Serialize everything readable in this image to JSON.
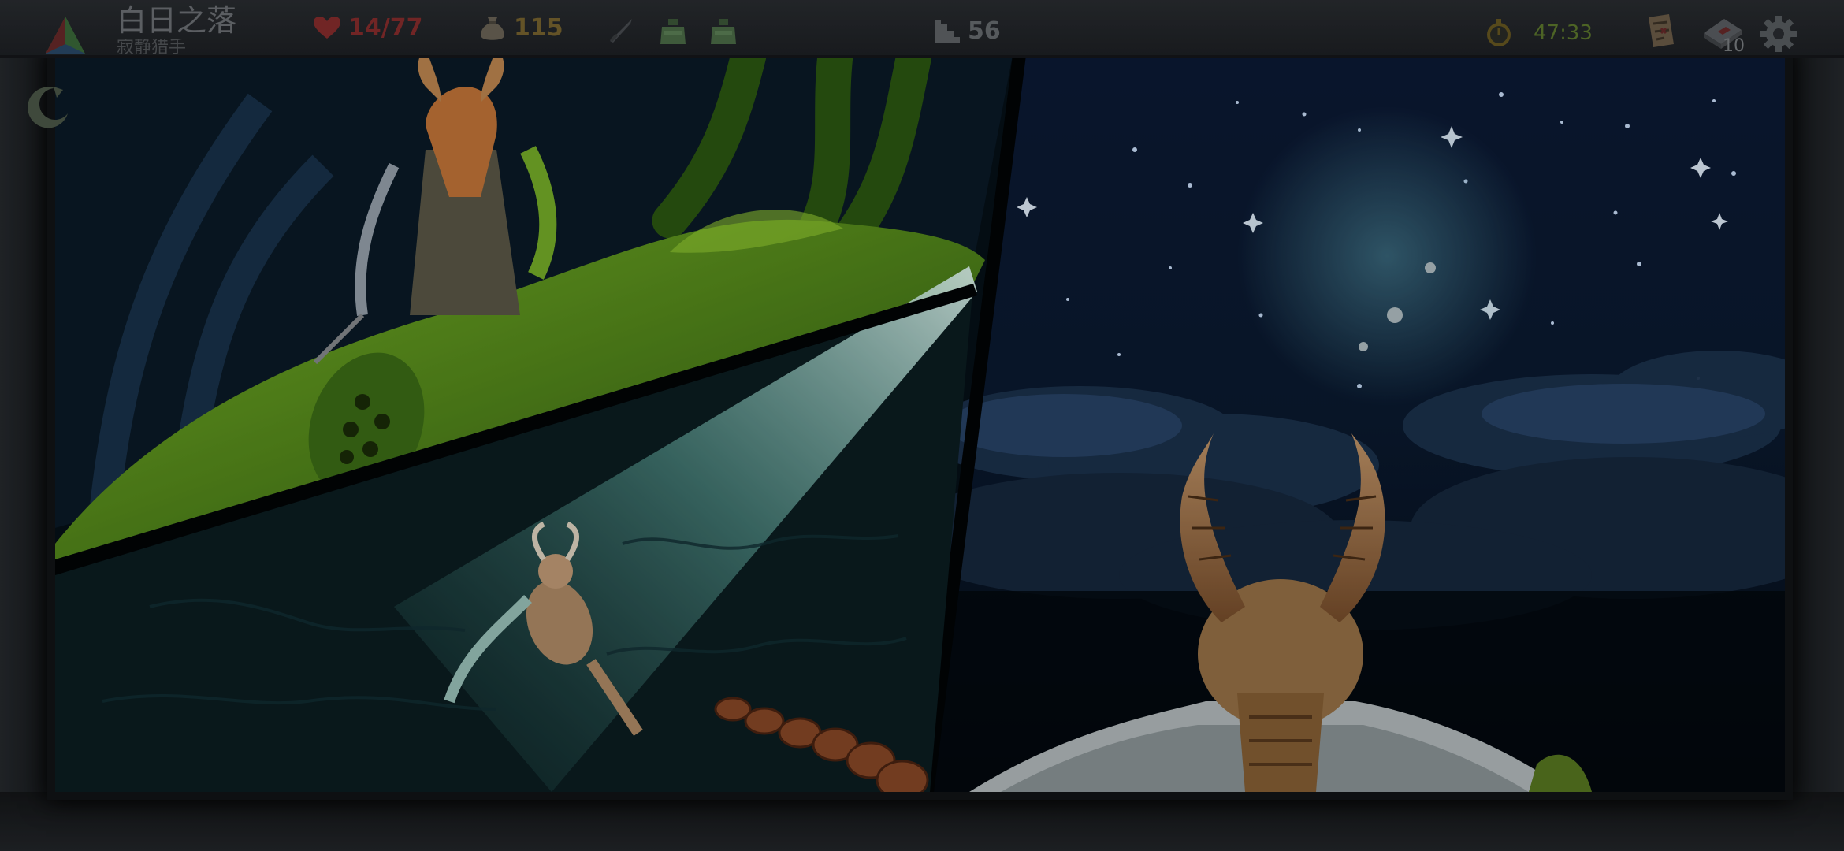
{
  "header": {
    "title": "白日之落",
    "subtitle": "寂静猎手"
  },
  "hud": {
    "health": "14/77",
    "gold": "115",
    "depth": "56",
    "timer": "47:33",
    "cards_count": "10"
  },
  "colors": {
    "health": "#8a2e2e",
    "gold": "#7a6630",
    "timer": "#5f7a2e",
    "moon": "#dfe8ea",
    "slime": "#5a8a1e"
  },
  "icons": {
    "logo": "tri-color-emblem-icon",
    "health": "heart-icon",
    "gold": "money-bag-icon",
    "weapon": "sword-icon",
    "potion1": "potion-icon",
    "potion2": "potion-icon",
    "depth": "stairs-icon",
    "timer": "stopwatch-icon",
    "map": "scroll-map-icon",
    "cards": "card-deck-icon",
    "settings": "gear-icon",
    "skip": "crescent-arrow-icon"
  }
}
